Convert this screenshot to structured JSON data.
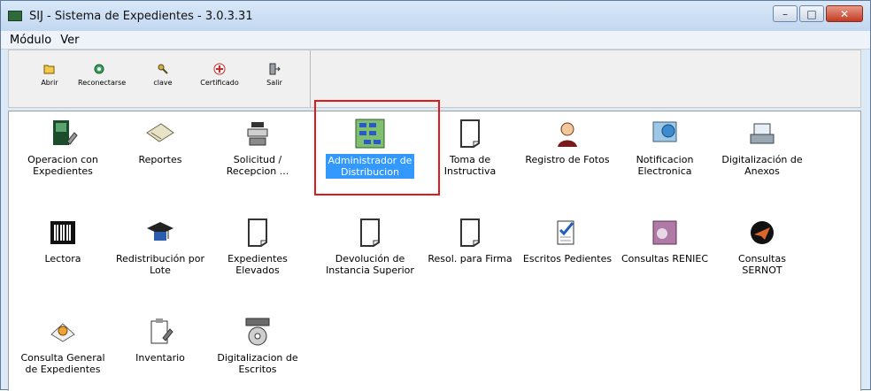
{
  "window": {
    "title": "SIJ - Sistema de Expedientes - 3.0.3.31"
  },
  "menu": [
    "Módulo",
    "Ver"
  ],
  "toolbar": [
    {
      "label": "Abrir",
      "icon": "folder-open-icon"
    },
    {
      "label": "Reconectarse",
      "icon": "reconnect-icon"
    },
    {
      "label": "clave",
      "icon": "key-icon"
    },
    {
      "label": "Certificado",
      "icon": "certificate-icon"
    },
    {
      "label": "Salir",
      "icon": "exit-icon"
    }
  ],
  "items": [
    {
      "label": "Operacion con\nExpedientes",
      "icon": "edit-document-icon"
    },
    {
      "label": "Reportes",
      "icon": "reports-icon"
    },
    {
      "label": "Solicitud /\nRecepcion ...",
      "icon": "request-reception-icon"
    },
    {
      "label": "Administrador de\nDistribucion",
      "icon": "distribution-admin-icon"
    },
    {
      "label": "Toma de\nInstructiva",
      "icon": "document-icon"
    },
    {
      "label": "Registro de Fotos",
      "icon": "person-photo-icon"
    },
    {
      "label": "Notificacion\nElectronica",
      "icon": "electronic-notification-icon"
    },
    {
      "label": "Digitalización de\nAnexos",
      "icon": "scanner-icon"
    },
    {
      "label": "Lectora",
      "icon": "barcode-icon"
    },
    {
      "label": "Redistribución por\nLote",
      "icon": "graduation-cap-icon"
    },
    {
      "label": "Expedientes\nElevados",
      "icon": "document-icon"
    },
    {
      "label": "Devolución de\nInstancia Superior",
      "icon": "document-icon"
    },
    {
      "label": "Resol. para Firma",
      "icon": "document-icon"
    },
    {
      "label": "Escritos Pedientes",
      "icon": "checklist-icon"
    },
    {
      "label": "Consultas RENIEC",
      "icon": "reniec-icon"
    },
    {
      "label": "Consultas\nSERNOT",
      "icon": "sernot-icon"
    },
    {
      "label": "Consulta General\nde Expedientes",
      "icon": "general-query-icon"
    },
    {
      "label": "Inventario",
      "icon": "inventory-icon"
    },
    {
      "label": "Digitalizacion de\nEscritos",
      "icon": "disc-scan-icon"
    }
  ]
}
